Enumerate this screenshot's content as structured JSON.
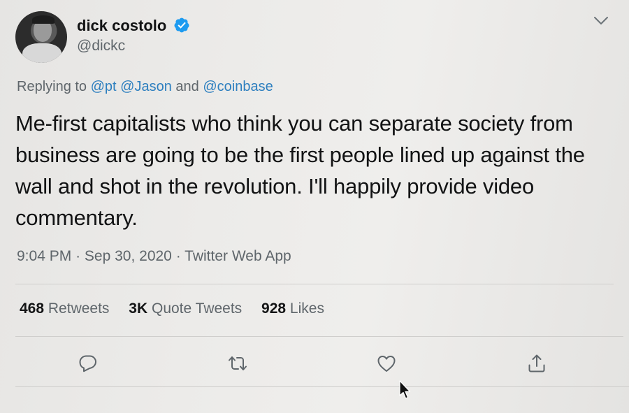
{
  "author": {
    "name": "dick costolo",
    "handle": "@dickc",
    "verified": true
  },
  "reply": {
    "prefix": "Replying to",
    "mention1": "@pt",
    "mention2": "@Jason",
    "conjunction": "and",
    "mention3": "@coinbase"
  },
  "tweet": {
    "text": "Me-first capitalists who think you can separate society from business are going to be the first people lined up against the wall and shot in the revolution. I'll happily provide video commentary."
  },
  "meta": {
    "time": "9:04 PM",
    "separator": "·",
    "date": "Sep 30, 2020",
    "client": "Twitter Web App"
  },
  "stats": {
    "retweets_count": "468",
    "retweets_label": "Retweets",
    "quotes_count": "3K",
    "quotes_label": "Quote Tweets",
    "likes_count": "928",
    "likes_label": "Likes"
  },
  "colors": {
    "accent": "#1d9bf0",
    "mention": "#2d7fbf",
    "secondary_text": "#5f666b"
  },
  "icons": {
    "verified": "verified-badge-icon",
    "caret": "chevron-down-icon",
    "reply": "reply-icon",
    "retweet": "retweet-icon",
    "like": "heart-icon",
    "share": "share-icon",
    "pointer": "mouse-pointer-icon"
  }
}
